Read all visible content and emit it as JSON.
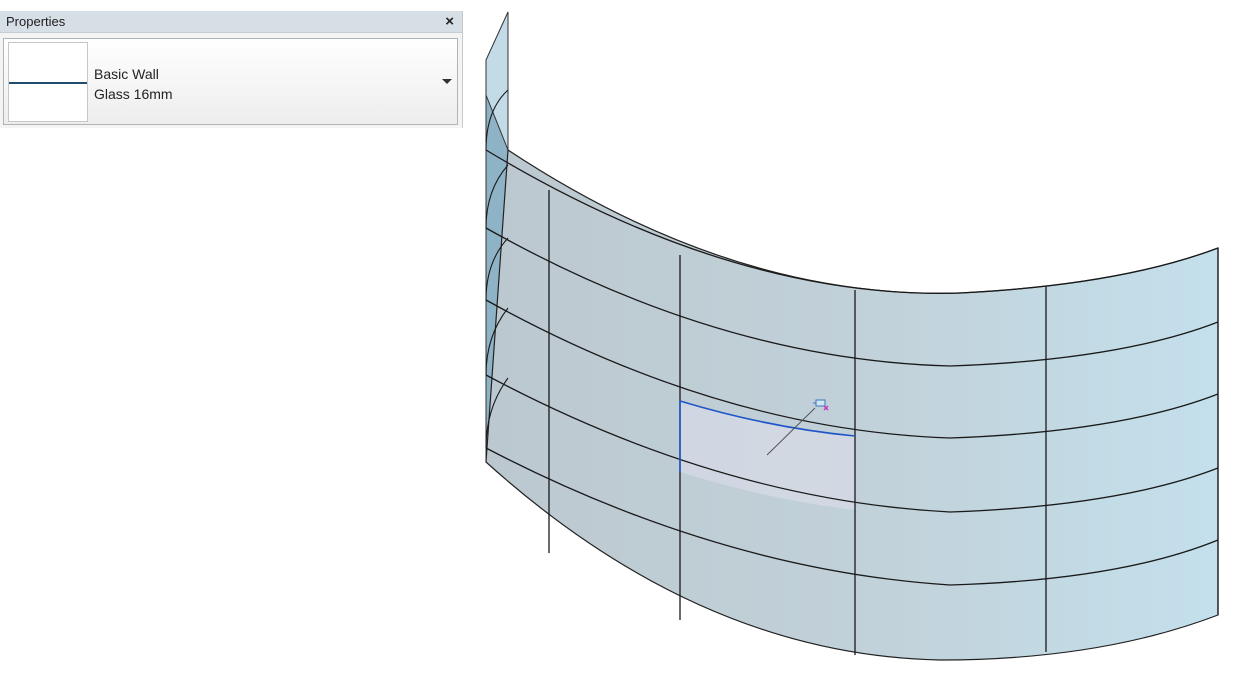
{
  "properties_panel": {
    "title": "Properties",
    "close_icon": "×",
    "type_selector": {
      "family": "Basic Wall",
      "type": "Glass 16mm"
    }
  },
  "viewport": {
    "glass_color": "#c4dbe6",
    "edge_color": "#6f8fa4",
    "highlight_color": "#1f55c8",
    "selected_panel_color": "#d3d8e3"
  }
}
